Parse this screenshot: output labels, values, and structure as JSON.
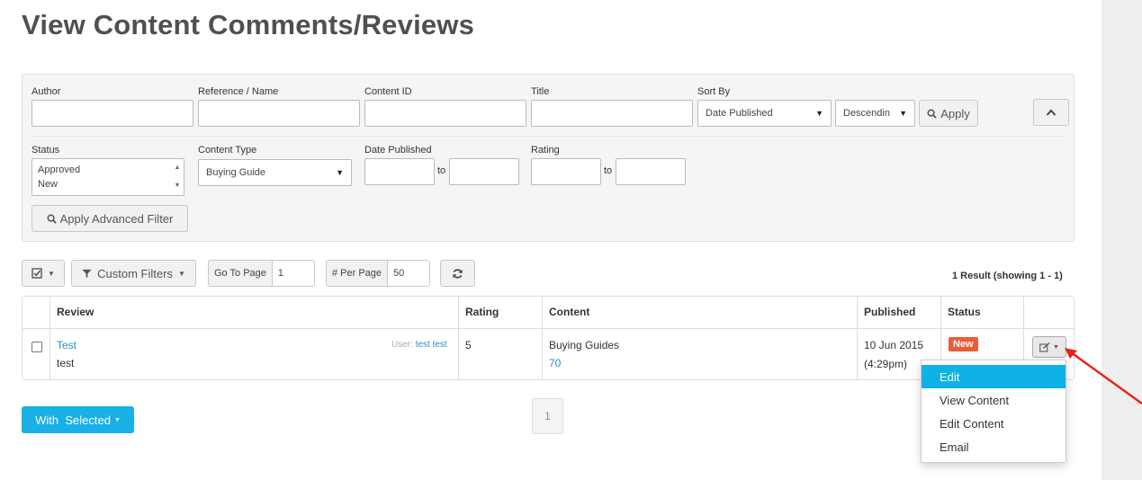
{
  "page_title": "View Content Comments/Reviews",
  "filters": {
    "author_label": "Author",
    "reference_label": "Reference / Name",
    "content_id_label": "Content ID",
    "title_label": "Title",
    "sort_by_label": "Sort By",
    "sort_by_value": "Date Published",
    "sort_order_value": "Descendin",
    "apply_label": "Apply",
    "status_label": "Status",
    "status_options": [
      "Approved",
      "New"
    ],
    "content_type_label": "Content Type",
    "content_type_value": "Buying Guide",
    "date_published_label": "Date Published",
    "rating_label": "Rating",
    "to_label": "to",
    "apply_advanced_label": "Apply Advanced Filter"
  },
  "toolbar": {
    "custom_filters_label": "Custom Filters",
    "go_to_page_label": "Go To Page",
    "go_to_page_value": "1",
    "per_page_label": "# Per Page",
    "per_page_value": "50",
    "result_count": "1 Result (showing 1 - 1)"
  },
  "table": {
    "headers": {
      "review": "Review",
      "rating": "Rating",
      "content": "Content",
      "published": "Published",
      "status": "Status"
    },
    "rows": [
      {
        "review_title": "Test",
        "review_body": "test",
        "user_prefix": "User:",
        "user_name": "test test",
        "rating": "5",
        "content_type": "Buying Guides",
        "content_id": "70",
        "published_date": "10 Jun 2015",
        "published_time": "(4:29pm)",
        "status": "New"
      }
    ]
  },
  "footer": {
    "with_selected_label": "With  Selected",
    "current_page": "1"
  },
  "action_menu": {
    "items": [
      "Edit",
      "View Content",
      "Edit Content",
      "Email"
    ],
    "active_index": 0
  },
  "colors": {
    "primary": "#19b0e8",
    "status_new": "#e55e3a",
    "link": "#2a8fc9",
    "annotation_arrow": "#e8231a"
  }
}
